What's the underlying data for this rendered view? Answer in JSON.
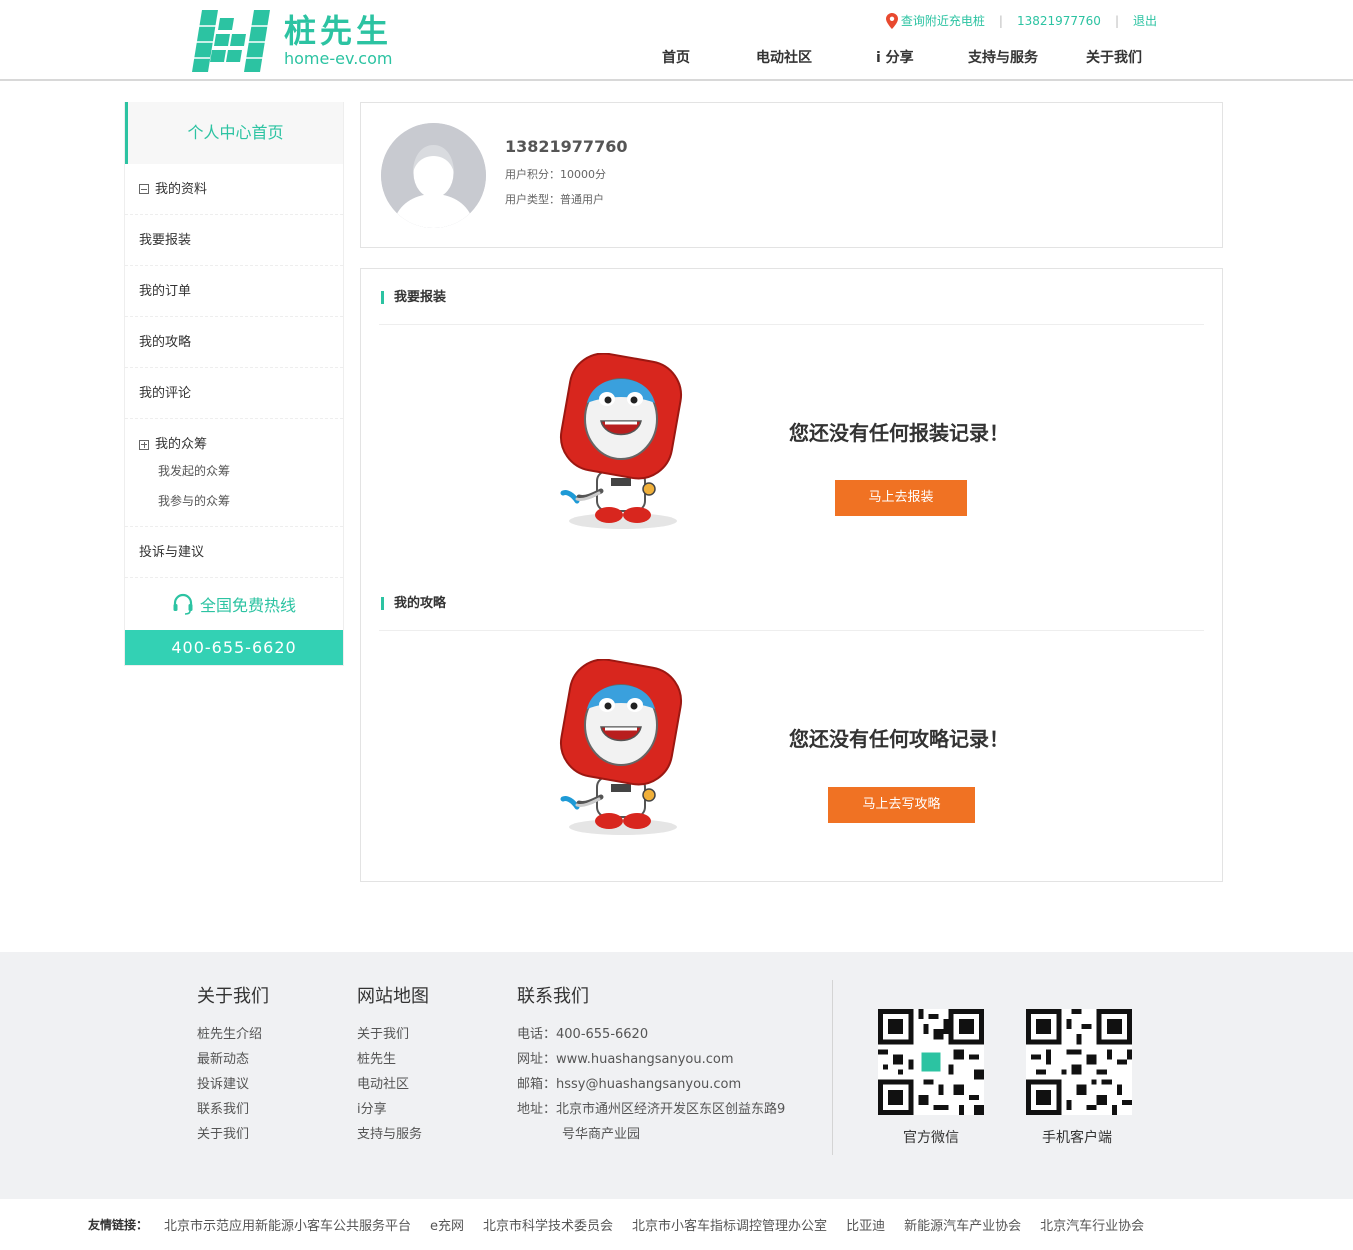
{
  "brand": {
    "name_cn": "桩先生",
    "domain": "home-ev.com",
    "accent": "#2cc3a2"
  },
  "topbar": {
    "find_chargers": "查询附近充电桩",
    "phone": "13821977760",
    "logout": "退出"
  },
  "nav": [
    "首页",
    "电动社区",
    "i 分享",
    "支持与服务",
    "关于我们"
  ],
  "sidebar": {
    "home": "个人中心首页",
    "items": [
      "我的资料",
      "我要报装",
      "我的订单",
      "我的攻略",
      "我的评论"
    ],
    "crowdfund": {
      "label": "我的众筹",
      "sub": [
        "我发起的众筹",
        "我参与的众筹"
      ]
    },
    "feedback": "投诉与建议",
    "hotline_label": "全国免费热线",
    "hotline_number": "400-655-6620"
  },
  "profile": {
    "name": "13821977760",
    "points": "用户积分：10000分",
    "type": "用户类型：普通用户"
  },
  "sections": [
    {
      "title": "我要报装",
      "empty": "您还没有任何报装记录！",
      "button": "马上去报装"
    },
    {
      "title": "我的攻略",
      "empty": "您还没有任何攻略记录！",
      "button": "马上去写攻略"
    }
  ],
  "footer": {
    "about": {
      "title": "关于我们",
      "items": [
        "桩先生介绍",
        "最新动态",
        "投诉建议",
        "联系我们",
        "关于我们"
      ]
    },
    "sitemap": {
      "title": "网站地图",
      "items": [
        "关于我们",
        "桩先生",
        "电动社区",
        "i分享",
        "支持与服务"
      ]
    },
    "contact": {
      "title": "联系我们",
      "items": [
        "电话：400-655-6620",
        "网址：www.huashangsanyou.com",
        "邮箱：hssy@huashangsanyou.com",
        "地址：北京市通州区经济开发区东区创益东路9",
        "号华商产业园"
      ]
    },
    "qr_wechat": "官方微信",
    "qr_app": "手机客户端"
  },
  "links": {
    "label": "友情链接：",
    "items": [
      "北京市示范应用新能源小客车公共服务平台",
      "e充网",
      "北京市科学技术委员会",
      "北京市小客车指标调控管理办公室",
      "比亚迪",
      "新能源汽车产业协会",
      "北京汽车行业协会"
    ]
  },
  "colors": {
    "accent": "#2cc3a2",
    "button": "#f07223",
    "hotline_bg": "#33d1b4"
  }
}
